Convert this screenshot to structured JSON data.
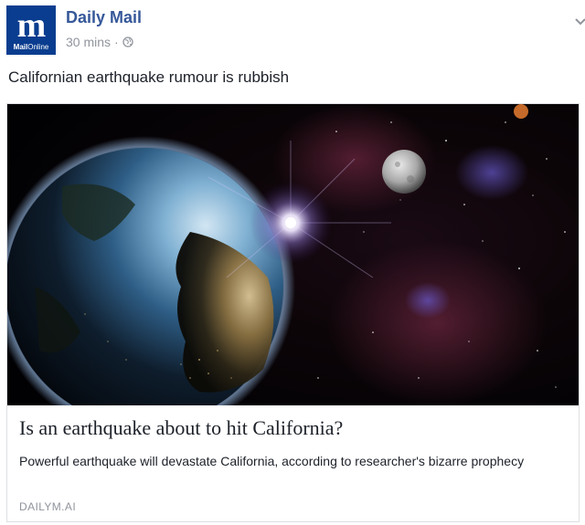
{
  "header": {
    "page_name": "Daily Mail",
    "timestamp": "30 mins",
    "separator": "·",
    "privacy_icon": "globe-icon",
    "menu_icon": "chevron-down-icon",
    "avatar": {
      "letter": "m",
      "sub_bold": "Mail",
      "sub_light": "Online",
      "color": "#0a3d8f"
    }
  },
  "post": {
    "text": "Californian earthquake rumour is rubbish"
  },
  "link_card": {
    "title": "Is an earthquake about to hit California?",
    "description": "Powerful earthquake will devastate California, according to researcher's bizarre prophecy",
    "domain": "DAILYM.AI"
  },
  "colors": {
    "link": "#365899",
    "meta": "#90949c",
    "text": "#1d2129",
    "border": "#dddfe2"
  }
}
